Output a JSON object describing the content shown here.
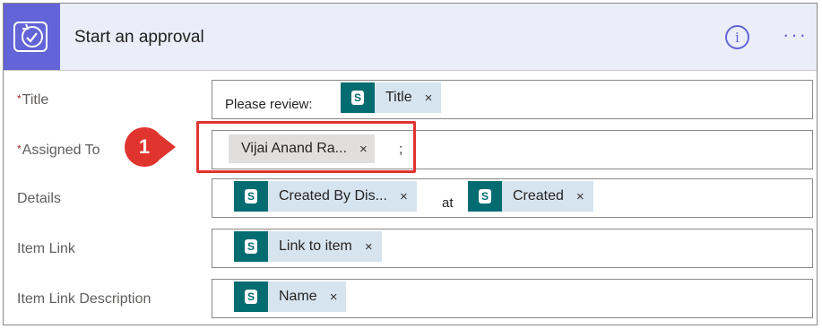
{
  "header": {
    "title": "Start an approval",
    "icon": "approval-check-icon",
    "info_glyph": "i",
    "more_glyph": "···"
  },
  "fields": {
    "title": {
      "label": "Title",
      "required": "*",
      "prefix_text": "Please review:",
      "tokens": [
        {
          "label": "Title",
          "remove": "×"
        }
      ]
    },
    "assigned_to": {
      "label": "Assigned To",
      "required": "*",
      "tokens": [
        {
          "label": "Vijai Anand Ra...",
          "remove": "×"
        }
      ],
      "separator": ";"
    },
    "details": {
      "label": "Details",
      "tokens": [
        {
          "label": "Created By Dis...",
          "remove": "×"
        },
        {
          "label": "Created",
          "remove": "×"
        }
      ],
      "joiner": "at"
    },
    "item_link": {
      "label": "Item Link",
      "tokens": [
        {
          "label": "Link to item",
          "remove": "×"
        }
      ]
    },
    "item_link_description": {
      "label": "Item Link Description",
      "tokens": [
        {
          "label": "Name",
          "remove": "×"
        }
      ]
    }
  },
  "callout": {
    "number": "1",
    "color": "#e0342f"
  },
  "colors": {
    "accent": "#6264d7",
    "header_bg": "#ebedf8",
    "token_bg": "#d6e4f0",
    "sharepoint": "#036c70"
  },
  "sharepoint_icon_glyph": "S"
}
